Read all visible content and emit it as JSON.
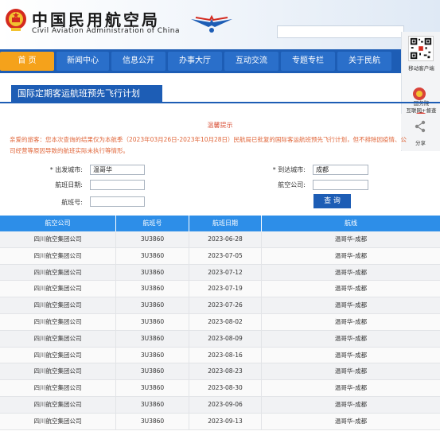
{
  "header": {
    "title_cn": "中国民用航空局",
    "title_en": "Civil Aviation Administration of China"
  },
  "nav": [
    "首 页",
    "新闻中心",
    "信息公开",
    "办事大厅",
    "互动交流",
    "专题专栏",
    "关于民航"
  ],
  "float": {
    "app_label": "移动客户端",
    "gov_label_1": "国务院",
    "gov_label_2": "互联网+督查",
    "share_label": "分享"
  },
  "section_title": "国际定期客运航班预先飞行计划",
  "notice": {
    "title": "温馨提示",
    "body": "亲爱的旅客：您本次查询的结果仅为本航季（2023年03月26日-2023年10月28日）民航局已批复的国际客运航班预先飞行计划，但不排除因疫情、公司经营等原因导致的航班实际未执行等情形。"
  },
  "form": {
    "from_label": "* 出发城市:",
    "from_value": "温哥华",
    "to_label": "* 到达城市:",
    "to_value": "成都",
    "date_label": "航班日期:",
    "date_value": "",
    "airline_label": "航空公司:",
    "airline_value": "",
    "flight_label": "航班号:",
    "flight_value": "",
    "query_label": "查 询"
  },
  "table": {
    "headers": [
      "航空公司",
      "航班号",
      "航班日期",
      "航线"
    ],
    "rows": [
      [
        "四川航空集团公司",
        "3U3860",
        "2023-06-28",
        "温哥华-成都"
      ],
      [
        "四川航空集团公司",
        "3U3860",
        "2023-07-05",
        "温哥华-成都"
      ],
      [
        "四川航空集团公司",
        "3U3860",
        "2023-07-12",
        "温哥华-成都"
      ],
      [
        "四川航空集团公司",
        "3U3860",
        "2023-07-19",
        "温哥华-成都"
      ],
      [
        "四川航空集团公司",
        "3U3860",
        "2023-07-26",
        "温哥华-成都"
      ],
      [
        "四川航空集团公司",
        "3U3860",
        "2023-08-02",
        "温哥华-成都"
      ],
      [
        "四川航空集团公司",
        "3U3860",
        "2023-08-09",
        "温哥华-成都"
      ],
      [
        "四川航空集团公司",
        "3U3860",
        "2023-08-16",
        "温哥华-成都"
      ],
      [
        "四川航空集团公司",
        "3U3860",
        "2023-08-23",
        "温哥华-成都"
      ],
      [
        "四川航空集团公司",
        "3U3860",
        "2023-08-30",
        "温哥华-成都"
      ],
      [
        "四川航空集团公司",
        "3U3860",
        "2023-09-06",
        "温哥华-成都"
      ],
      [
        "四川航空集团公司",
        "3U3860",
        "2023-09-13",
        "温哥华-成都"
      ]
    ]
  }
}
